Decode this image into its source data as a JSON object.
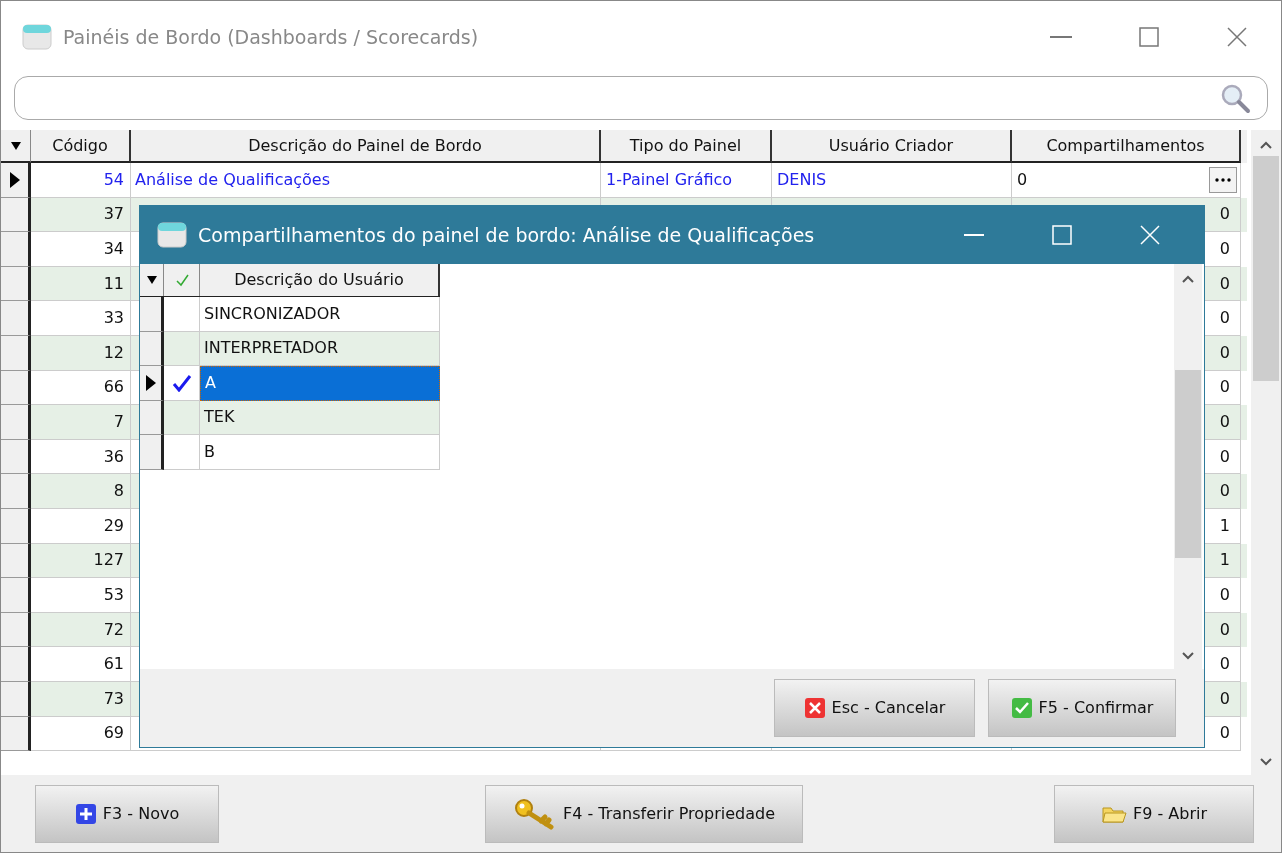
{
  "window": {
    "title": "Painéis de Bordo (Dashboards / Scorecards)"
  },
  "table": {
    "columns": [
      "Código",
      "Descrição do Painel de Bordo",
      "Tipo do Painel",
      "Usuário Criador",
      "Compartilhamentos"
    ],
    "rows": [
      {
        "code": "54",
        "description": "Análise de Qualificações",
        "type": "1-Painel Gráfico",
        "creator": "DENIS",
        "shares": "0",
        "selected": true
      },
      {
        "code": "37",
        "shares": "0",
        "selected": false
      },
      {
        "code": "34",
        "shares": "0",
        "selected": false
      },
      {
        "code": "11",
        "shares": "0",
        "selected": false
      },
      {
        "code": "33",
        "shares": "0",
        "selected": false
      },
      {
        "code": "12",
        "shares": "0",
        "selected": false
      },
      {
        "code": "66",
        "shares": "0",
        "selected": false
      },
      {
        "code": "7",
        "shares": "0",
        "selected": false
      },
      {
        "code": "36",
        "shares": "0",
        "selected": false
      },
      {
        "code": "8",
        "shares": "0",
        "selected": false
      },
      {
        "code": "29",
        "shares": "1",
        "selected": false
      },
      {
        "code": "127",
        "shares": "1",
        "selected": false
      },
      {
        "code": "53",
        "shares": "0",
        "selected": false
      },
      {
        "code": "72",
        "shares": "0",
        "selected": false
      },
      {
        "code": "61",
        "shares": "0",
        "selected": false
      },
      {
        "code": "73",
        "shares": "0",
        "selected": false
      },
      {
        "code": "69",
        "shares": "0",
        "selected": false
      }
    ]
  },
  "dialog": {
    "title": "Compartilhamentos do painel de bordo: Análise de Qualificações",
    "column": "Descrição do Usuário",
    "rows": [
      {
        "name": "SINCRONIZADOR",
        "checked": false,
        "selected": false
      },
      {
        "name": "INTERPRETADOR",
        "checked": false,
        "selected": false
      },
      {
        "name": "A",
        "checked": true,
        "selected": true
      },
      {
        "name": "TEK",
        "checked": false,
        "selected": false
      },
      {
        "name": "B",
        "checked": false,
        "selected": false
      }
    ],
    "buttons": [
      {
        "kind": "cancel",
        "label": "Esc - Cancelar"
      },
      {
        "kind": "confirm",
        "label": "F5 - Confirmar"
      }
    ]
  },
  "buttons": [
    {
      "kind": "new",
      "label": "F3 - Novo"
    },
    {
      "kind": "transfer",
      "label": "F4 - Transferir Propriedade"
    },
    {
      "kind": "open",
      "label": "F9 - Abrir"
    }
  ]
}
